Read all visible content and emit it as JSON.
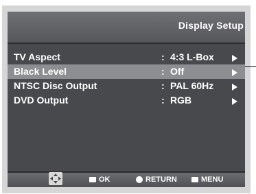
{
  "header": {
    "title": "Display Setup"
  },
  "menu": {
    "items": [
      {
        "label": "TV Aspect",
        "colon": ":",
        "value": "4:3 L-Box",
        "selected": false
      },
      {
        "label": "Black Level",
        "colon": ":",
        "value": "Off",
        "selected": true
      },
      {
        "label": "NTSC Disc Output",
        "colon": ":",
        "value": "PAL 60Hz",
        "selected": false
      },
      {
        "label": "DVD Output",
        "colon": ":",
        "value": "RGB",
        "selected": false
      }
    ]
  },
  "footer": {
    "ok_label": "OK",
    "return_label": "RETURN",
    "menu_label": "MENU"
  },
  "colors": {
    "screen_bg": "#47494c",
    "highlight": "#8c8e91",
    "text": "#ffffff"
  },
  "icons": [
    "directional-pad-icon",
    "ok-icon",
    "return-icon",
    "menu-icon",
    "arrow-right-icon"
  ]
}
